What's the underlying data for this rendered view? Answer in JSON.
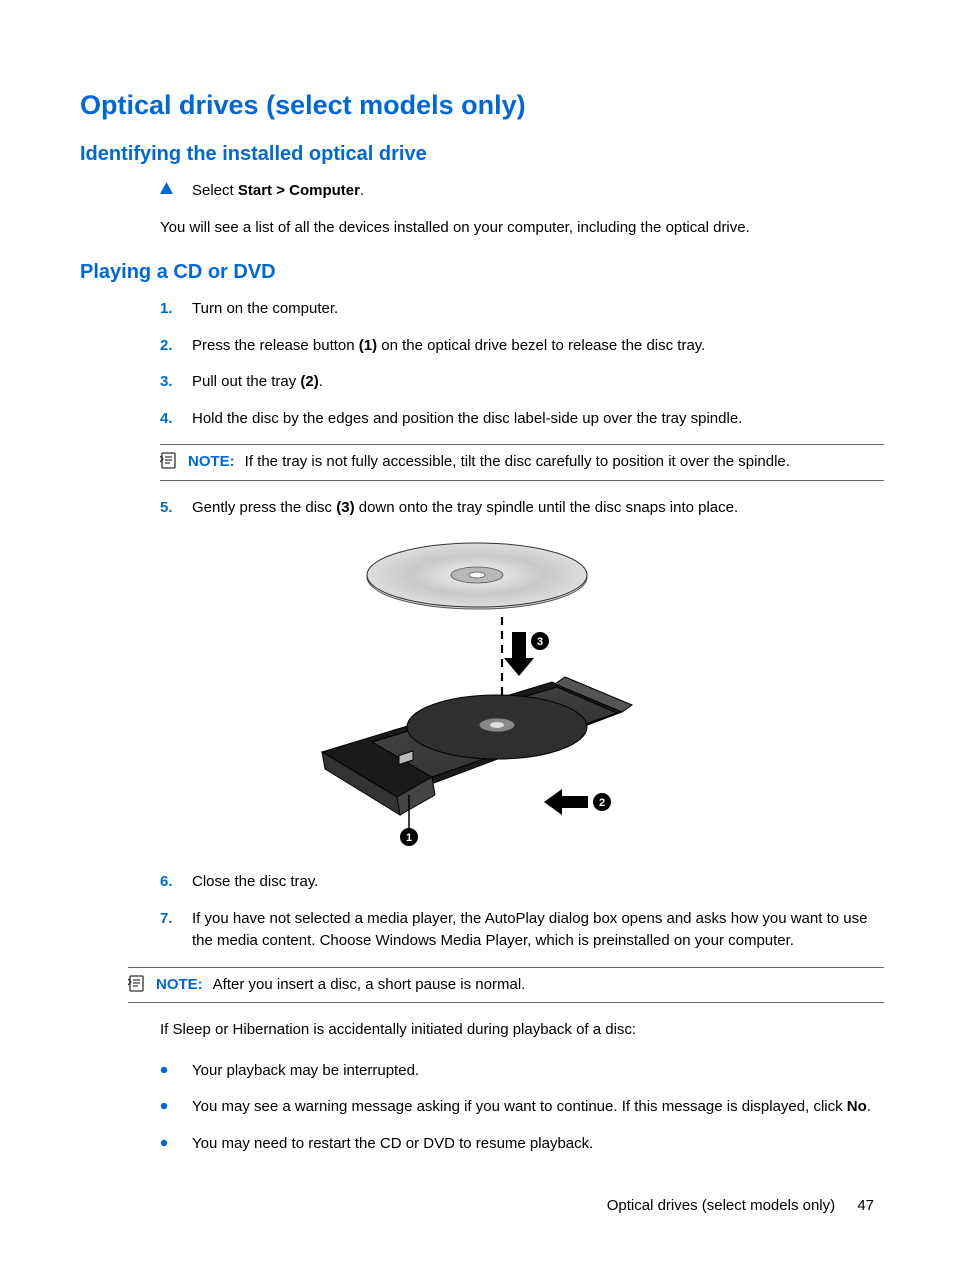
{
  "page_title": "Optical drives (select models only)",
  "section1": {
    "heading": "Identifying the installed optical drive",
    "step_prefix": "Select ",
    "step_bold": "Start > Computer",
    "step_suffix": ".",
    "followup": "You will see a list of all the devices installed on your computer, including the optical drive."
  },
  "section2": {
    "heading": "Playing a CD or DVD",
    "steps": [
      {
        "num": "1.",
        "text": "Turn on the computer."
      },
      {
        "num": "2.",
        "pre": "Press the release button ",
        "bold": "(1)",
        "post": " on the optical drive bezel to release the disc tray."
      },
      {
        "num": "3.",
        "pre": "Pull out the tray ",
        "bold": "(2)",
        "post": "."
      },
      {
        "num": "4.",
        "text": "Hold the disc by the edges and position the disc label-side up over the tray spindle."
      },
      {
        "num": "5.",
        "pre": "Gently press the disc ",
        "bold": "(3)",
        "post": " down onto the tray spindle until the disc snaps into place."
      },
      {
        "num": "6.",
        "text": "Close the disc tray."
      },
      {
        "num": "7.",
        "text": "If you have not selected a media player, the AutoPlay dialog box opens and asks how you want to use the media content. Choose Windows Media Player, which is preinstalled on your computer."
      }
    ],
    "note1": {
      "label": "NOTE:",
      "text": "If the tray is not fully accessible, tilt the disc carefully to position it over the spindle."
    },
    "note2": {
      "label": "NOTE:",
      "text": "After you insert a disc, a short pause is normal."
    },
    "sleep_intro": "If Sleep or Hibernation is accidentally initiated during playback of a disc:",
    "bullets": [
      {
        "text": "Your playback may be interrupted."
      },
      {
        "pre": "You may see a warning message asking if you want to continue. If this message is displayed, click ",
        "bold": "No",
        "post": "."
      },
      {
        "text": "You may need to restart the CD or DVD to resume playback."
      }
    ]
  },
  "footer": {
    "section": "Optical drives (select models only)",
    "page": "47"
  }
}
